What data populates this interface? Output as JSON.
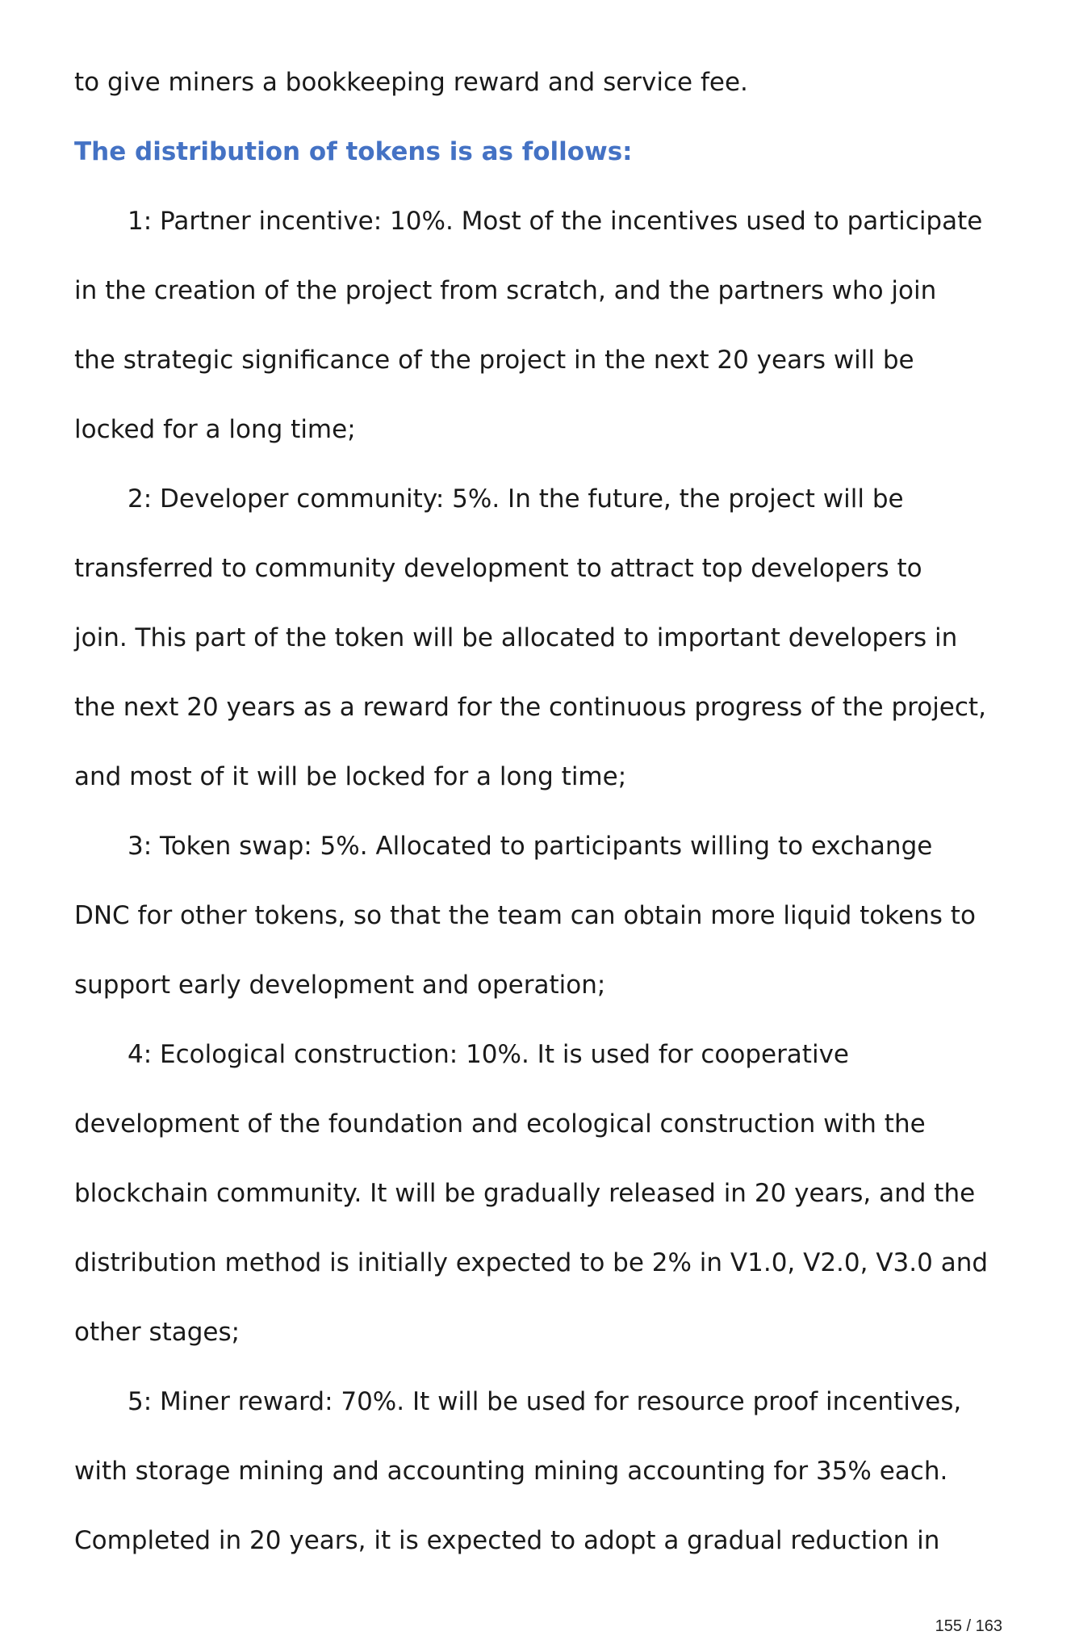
{
  "lines": [
    "to give miners a bookkeeping reward and service fee.",
    "The distribution of tokens is as follows:",
    "1: Partner incentive: 10%. Most of the incentives used to participate",
    "in the creation of the project from scratch, and the partners who join",
    "the strategic significance of the project in the next 20 years will be",
    "locked for a long time;",
    "2: Developer community: 5%. In the future, the project will be",
    "transferred to community development to attract top developers to",
    "join. This part of the token will be allocated to important developers in",
    "the next 20 years as a reward for the continuous progress of the project,",
    "and most of it will be locked for a long time;",
    "3: Token swap: 5%. Allocated to participants willing to exchange",
    "DNC for other tokens, so that the team can obtain more liquid tokens to",
    "support early development and operation;",
    "4: Ecological construction: 10%. It is used for cooperative",
    "development of the foundation and ecological construction with the",
    "blockchain community. It will be gradually released in 20 years, and the",
    "distribution method is initially expected to be 2% in V1.0, V2.0, V3.0 and",
    "other stages;",
    "5: Miner reward: 70%. It will be used for resource proof incentives,",
    "with storage mining and accounting mining accounting for 35% each.",
    "Completed in 20 years, it is expected to adopt a gradual reduction in"
  ],
  "page_number": "155 / 163",
  "colors": {
    "heading": "#4472c4",
    "text": "#1a1a1a"
  }
}
